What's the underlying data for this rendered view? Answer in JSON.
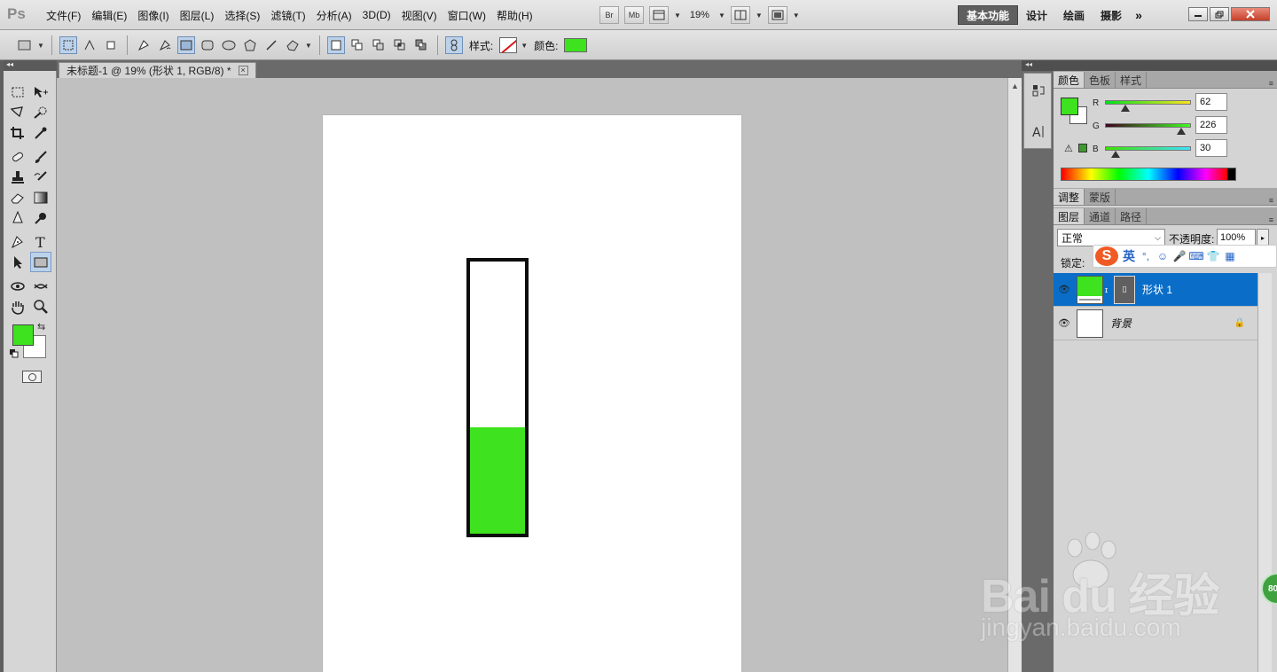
{
  "menubar": {
    "logo": "Ps",
    "menus": [
      "文件(F)",
      "编辑(E)",
      "图像(I)",
      "图层(L)",
      "选择(S)",
      "滤镜(T)",
      "分析(A)",
      "3D(D)",
      "视图(V)",
      "窗口(W)",
      "帮助(H)"
    ],
    "bridge_label": "Br",
    "minibridge_label": "Mb",
    "zoom": "19%",
    "workspaces": [
      "基本功能",
      "设计",
      "绘画",
      "摄影"
    ],
    "workspace_more": "»"
  },
  "options_bar": {
    "style_label": "样式:",
    "color_label": "颜色:",
    "shape_color": "#3ee21e"
  },
  "document": {
    "tab_title": "未标题-1 @ 19% (形状 1, RGB/8) *",
    "tab_close": "×",
    "fill_color": "#3ee21e",
    "gauge_fill_fraction": 0.39
  },
  "color_panel": {
    "tabs": [
      "颜色",
      "色板",
      "样式"
    ],
    "foreground": "#3ee21e",
    "channels": [
      {
        "label": "R",
        "value": "62",
        "fraction": 0.24
      },
      {
        "label": "G",
        "value": "226",
        "fraction": 0.89
      },
      {
        "label": "B",
        "value": "30",
        "fraction": 0.12
      }
    ],
    "gamut_swatch": "#3f9a2e"
  },
  "adjust_panel": {
    "tabs": [
      "调整",
      "蒙版"
    ]
  },
  "layers_panel": {
    "tabs": [
      "图层",
      "通道",
      "路径"
    ],
    "blend_mode": "正常",
    "opacity_label": "不透明度:",
    "opacity_value": "100%",
    "lock_label": "锁定:",
    "layers": [
      {
        "name": "形状 1",
        "thumb_color": "#3ee21e",
        "selected": true
      },
      {
        "name": "背景",
        "thumb_color": "#ffffff",
        "selected": false
      }
    ]
  },
  "ime": {
    "logo": "S",
    "lang": "英"
  },
  "watermark": {
    "brand": "Bai du 经验",
    "url": "jingyan.baidu.com"
  },
  "badge": "80"
}
